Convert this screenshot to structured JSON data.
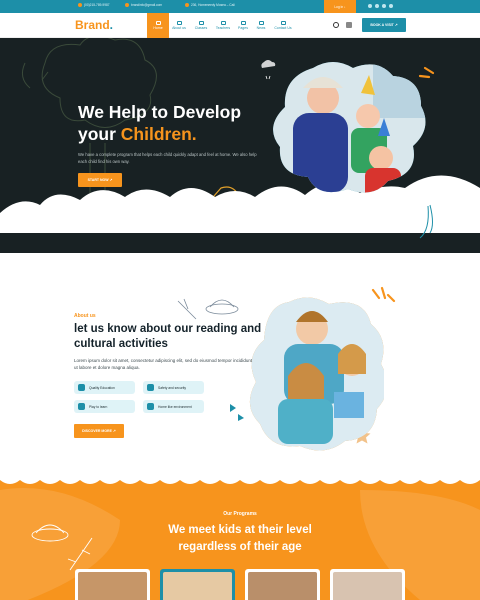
{
  "topbar": {
    "phone": "(00)215-789-9987",
    "email": "brandinfo@gmail.com",
    "address": "236, Homeneedy Mosea – Cali",
    "login": "Log in ↓"
  },
  "nav": {
    "brand": "Brand",
    "brand_dot": ".",
    "items": [
      {
        "label": "Home"
      },
      {
        "label": "About us"
      },
      {
        "label": "Classes"
      },
      {
        "label": "Teachers"
      },
      {
        "label": "Pages"
      },
      {
        "label": "News"
      },
      {
        "label": "Contact Us"
      }
    ],
    "book_label": "BOOK A VISIT  ↗"
  },
  "hero": {
    "title_line1": "We Help to Develop",
    "title_line2_plain": "your ",
    "title_line2_highlight": "Children.",
    "description": "We have a complete program that helps each child quickly adapt and feel at home. We also help each child find his own way.",
    "button": "START NOW  ↗"
  },
  "about": {
    "label": "About us",
    "title": "let us know about our reading and cultural activities",
    "description": "Lorem ipsum dolor sit amet, consectetur adipiscing elit, sed do eiusmod tempor incididunt ut labore et dolore magna aliqua.",
    "features": [
      {
        "label": "Quality Education",
        "icon": "book-icon"
      },
      {
        "label": "Safety and security",
        "icon": "shield-icon"
      },
      {
        "label": "Play to learn",
        "icon": "toy-icon"
      },
      {
        "label": "Home like environment",
        "icon": "home-icon"
      }
    ],
    "button": "DISCOVER MORE  ↗"
  },
  "programs": {
    "label": "Our Programs",
    "title_line1": "We meet kids at their level",
    "title_line2": "regardless of their age"
  },
  "colors": {
    "teal": "#1d8fa8",
    "orange": "#f7941d",
    "dark": "#182123"
  }
}
